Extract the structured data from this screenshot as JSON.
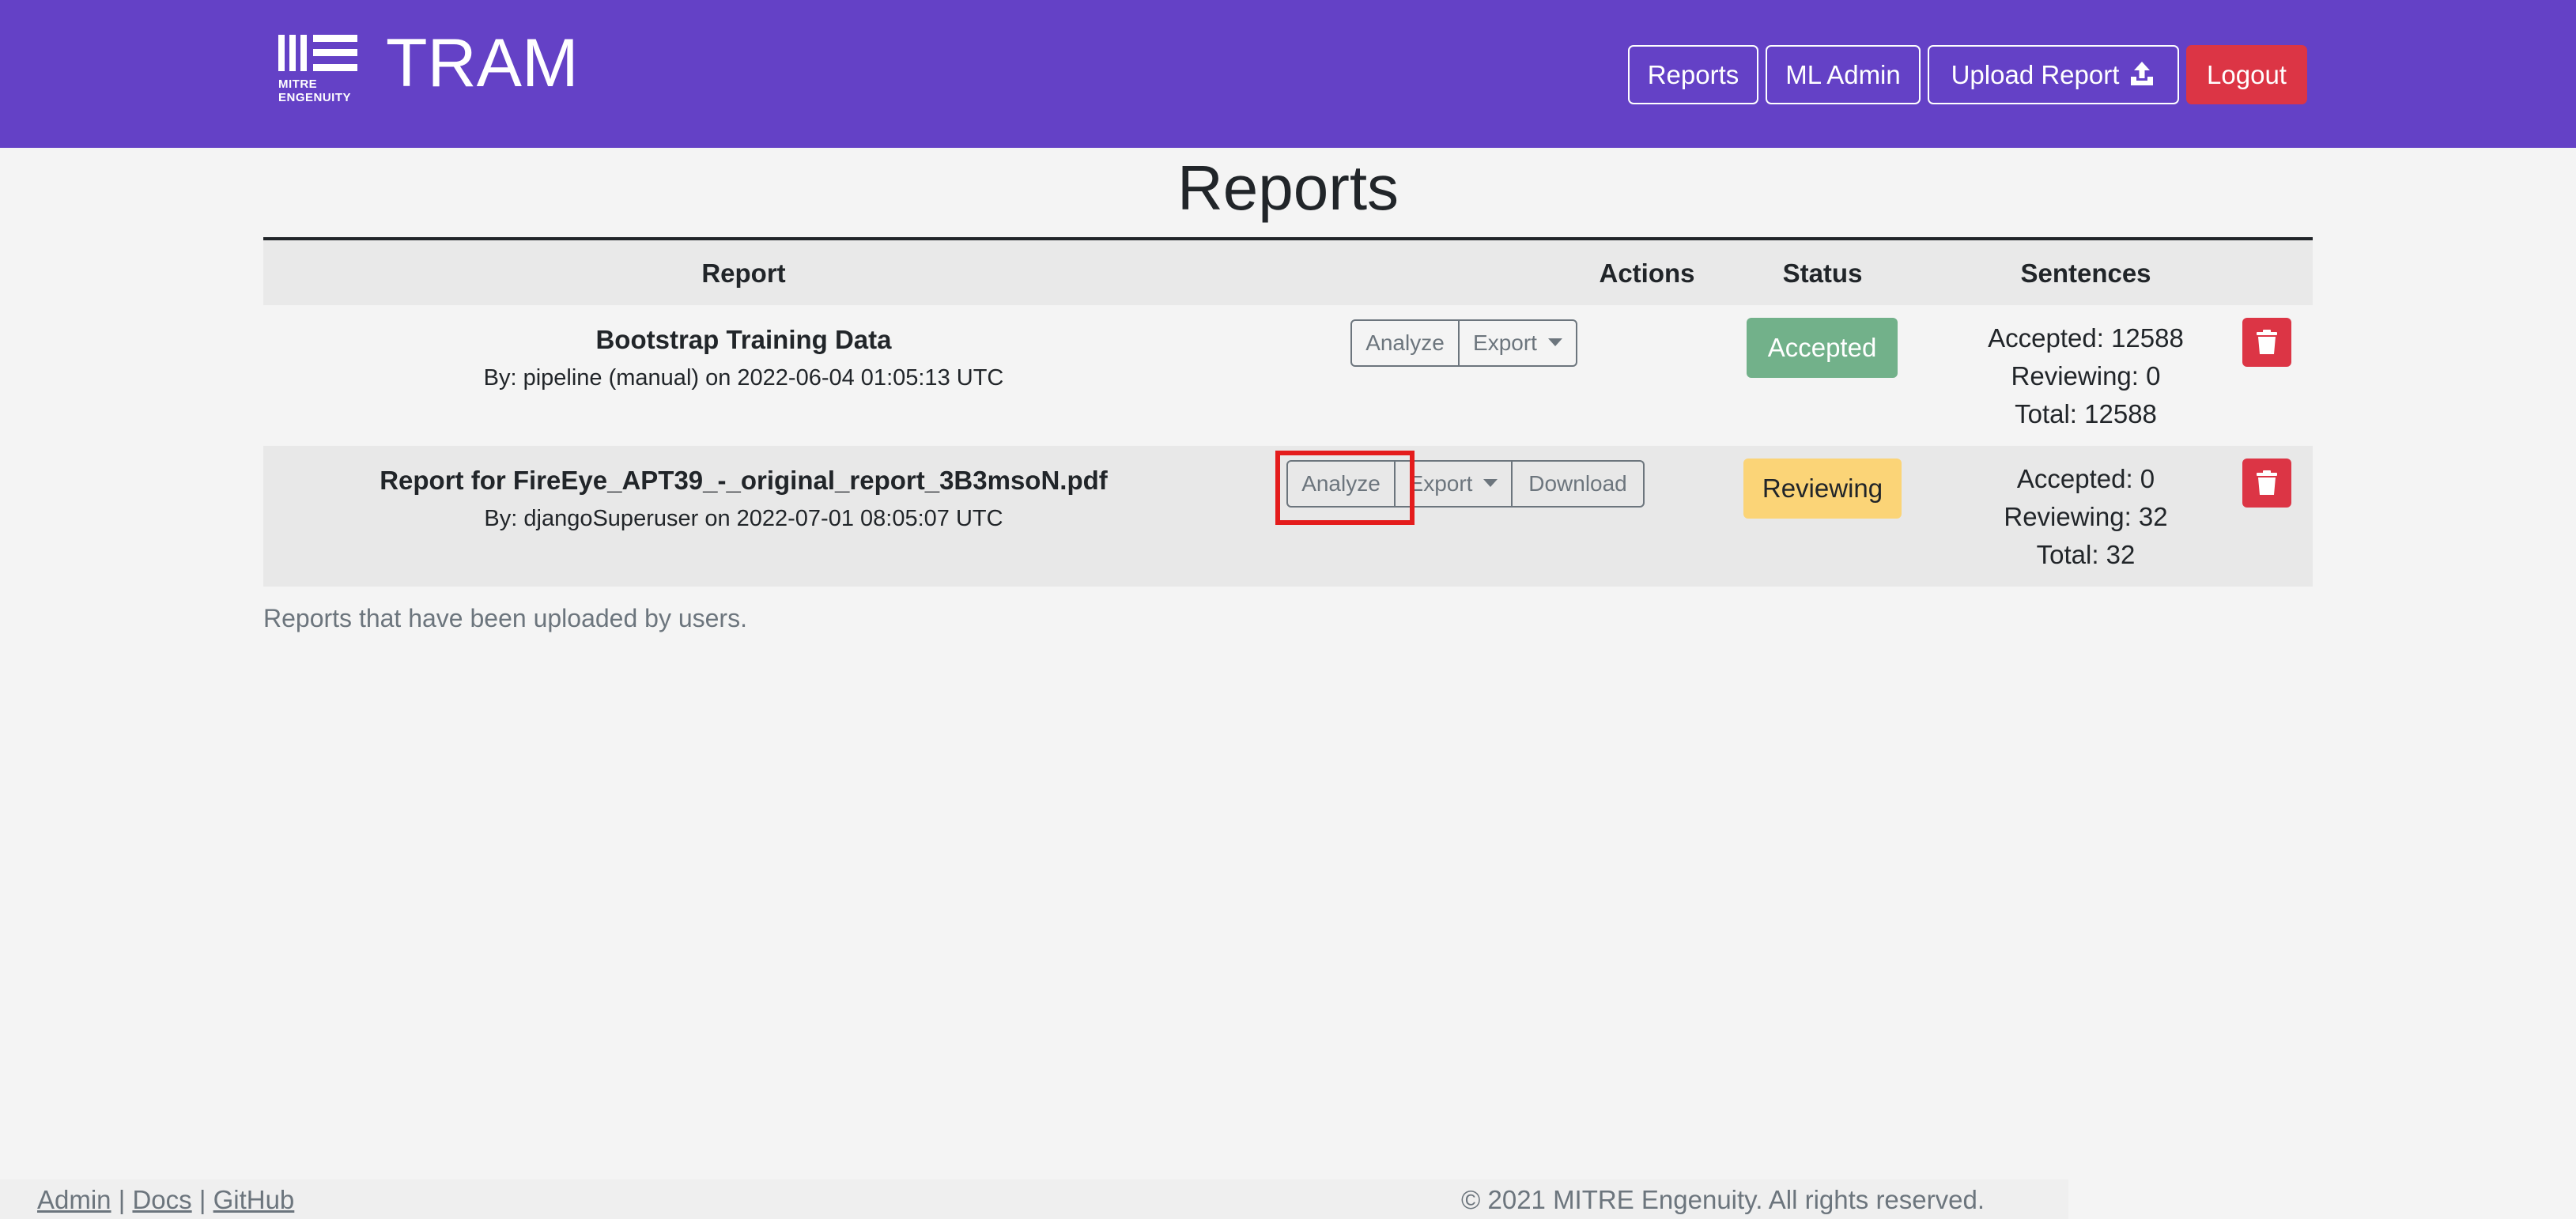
{
  "header": {
    "logo_text": "MITRE ENGENUITY",
    "title": "TRAM",
    "nav": {
      "reports": "Reports",
      "ml_admin": "ML Admin",
      "upload_report": "Upload Report",
      "logout": "Logout"
    },
    "colors": {
      "background": "#6441c6",
      "logout": "#dc3545"
    }
  },
  "page": {
    "title": "Reports"
  },
  "table": {
    "headers": [
      "Report",
      "Actions",
      "Status",
      "Sentences"
    ],
    "rows": [
      {
        "title": "Bootstrap Training Data",
        "by": "By: pipeline (manual) on 2022-06-04 01:05:13 UTC",
        "actions": {
          "analyze": "Analyze",
          "export": "Export"
        },
        "status": "Accepted",
        "sentences": {
          "accepted": "Accepted: 12588",
          "reviewing": "Reviewing: 0",
          "total": "Total: 12588"
        }
      },
      {
        "title": "Report for FireEye_APT39_-_original_report_3B3msoN.pdf",
        "by": "By: djangoSuperuser on 2022-07-01 08:05:07 UTC",
        "actions": {
          "analyze": "Analyze",
          "export": "Export",
          "download": "Download"
        },
        "status": "Reviewing",
        "sentences": {
          "accepted": "Accepted: 0",
          "reviewing": "Reviewing: 32",
          "total": "Total: 32"
        }
      }
    ],
    "status_colors": {
      "accepted": "#72b18a",
      "reviewing": "#fbd477"
    },
    "icons": {
      "delete": "trash-icon",
      "upload": "upload-icon",
      "export_toggle": "caret-down-icon"
    },
    "caption": "Reports that have been uploaded by users."
  },
  "footer": {
    "links": [
      "Admin",
      "Docs",
      "GitHub"
    ],
    "separator": "|",
    "copyright": "© 2021 MITRE Engenuity. All rights reserved."
  }
}
